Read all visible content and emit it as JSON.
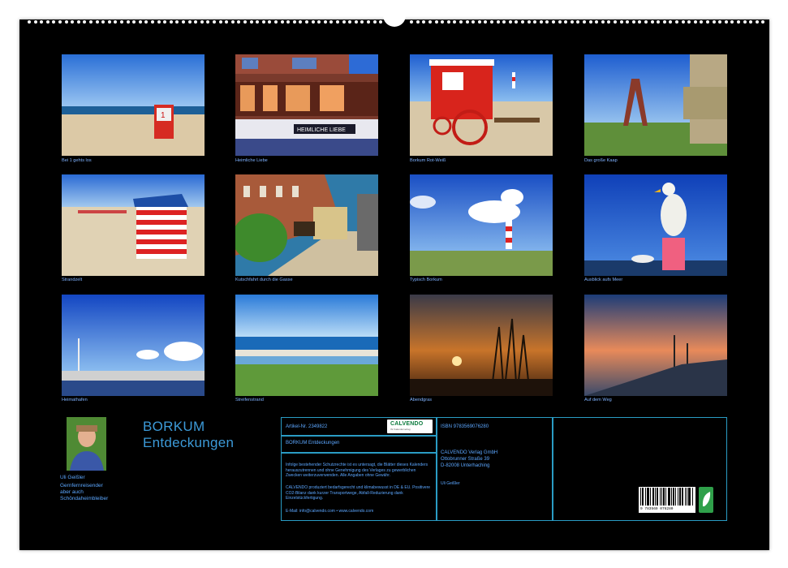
{
  "calendar": {
    "title_line1": "BORKUM",
    "title_line2": "Entdeckungen"
  },
  "months": [
    {
      "caption": "Bei 1 gehts los"
    },
    {
      "caption": "Heimliche Liebe"
    },
    {
      "caption": "Borkum Rot-Weiß"
    },
    {
      "caption": "Das große Kaap"
    },
    {
      "caption": "Strandzelt"
    },
    {
      "caption": "Kutschfahrt durch die Gasse"
    },
    {
      "caption": "Typisch Borkum"
    },
    {
      "caption": "Ausblick aufs Meer"
    },
    {
      "caption": "Heimathafen"
    },
    {
      "caption": "Streifenstrand"
    },
    {
      "caption": "Abendgras"
    },
    {
      "caption": "Auf dem Weg"
    }
  ],
  "photo_texts": {
    "sign_heimliche_liebe": "HEIMLICHE LIEBE",
    "beach_chair_number": "1"
  },
  "author": {
    "name": "Uli Geißler",
    "description_lines": [
      "Gernfernreisender",
      "aber auch",
      "Schöndaheimbleiber"
    ]
  },
  "info": {
    "article_no": "Artikel-Nr. 2349822",
    "product_title": "BORKUM Entdeckungen",
    "legal_text": "Infolge bestehender Schutzrechte ist es untersagt, die Blätter dieses Kalenders herauszutrennen und ohne Genehmigung des Verlages zu gewerblichen Zwecken weiterzuverwenden. Alle Angaben ohne Gewähr.",
    "eco_text": "CALVENDO produziert bedarfsgerecht und klimabewusst in DE & EU. Positivere CO2-Bilanz dank kurzer Transportwege, Abfall-Reduzierung dank Einzelstückfertigung.",
    "contact": "E-Mail: info@calvendo.com • www.calvendo.com",
    "isbn": "ISBN 9783569076280",
    "publisher": "CALVENDO Verlag GmbH",
    "street": "Ottobrunner Straße 39",
    "city": "D-82008 Unterhaching",
    "author_credit": "Uli Geißler",
    "logo": "CALVENDO",
    "logo_sub": "Ihr Kalenderverlag",
    "barcode_number": "9 783569 076280"
  },
  "colors": {
    "background": "#000000",
    "caption": "#7fb2ff",
    "title": "#3c9ad8",
    "frame": "#2a9cc4"
  }
}
